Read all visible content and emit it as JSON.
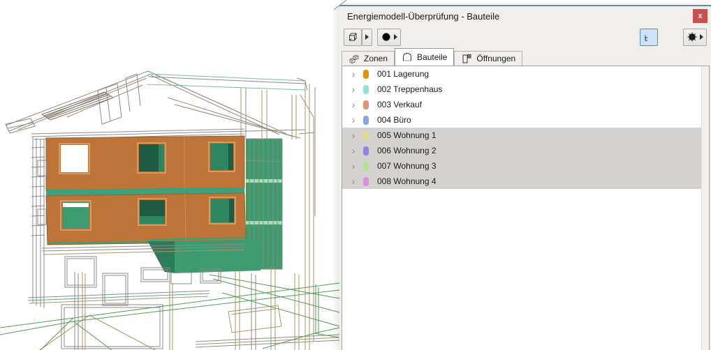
{
  "window": {
    "title": "Energiemodell-Überprüfung - Bauteile",
    "close_label": "x"
  },
  "toolbar": {
    "left": [
      {
        "name": "show-model",
        "icon": "cube-icon",
        "has_dropdown": true
      },
      {
        "name": "refresh",
        "icon": "refresh-icon",
        "has_dropdown": true
      }
    ],
    "right": [
      {
        "name": "tree-view",
        "icon": "tree-view-icon",
        "active": true
      },
      {
        "name": "flat-view",
        "icon": "list-view-icon",
        "active": false
      },
      {
        "name": "settings",
        "icon": "gear-icon",
        "has_dropdown": true
      }
    ]
  },
  "tabs": [
    {
      "label": "Zonen",
      "icon": "zones-cubes-icon",
      "active": false
    },
    {
      "label": "Bauteile",
      "icon": "building-arch-icon",
      "active": true
    },
    {
      "label": "Öffnungen",
      "icon": "door-icon",
      "active": false
    }
  ],
  "list": {
    "items": [
      {
        "label": "001 Lagerung",
        "color": "#E3920F",
        "selected": false
      },
      {
        "label": "002 Treppenhaus",
        "color": "#8FE2DC",
        "selected": false
      },
      {
        "label": "003 Verkauf",
        "color": "#DB9579",
        "selected": false
      },
      {
        "label": "004 Büro",
        "color": "#85A8DC",
        "selected": false
      },
      {
        "label": "005 Wohnung 1",
        "color": "#E0DB8D",
        "selected": true
      },
      {
        "label": "006 Wohnung 2",
        "color": "#8F85E0",
        "selected": true
      },
      {
        "label": "007 Wohnung 3",
        "color": "#AEE392",
        "selected": true
      },
      {
        "label": "008 Wohnung 4",
        "color": "#D990DE",
        "selected": true
      }
    ],
    "chevron": "›"
  },
  "scene": {
    "colors": {
      "wall_orange": "#BE7338",
      "slab_teal": "#3FA07C",
      "glass_dark": "#1E5C46",
      "glass_mid": "#2E8560",
      "panel_green": "#3D9B72",
      "terrace_green": "#2A7C5A",
      "wire_gray": "#8B8B88",
      "wire_tan": "#A8946A",
      "wire_teal": "#7FB8A8",
      "site_green": "#4F9E55"
    }
  }
}
